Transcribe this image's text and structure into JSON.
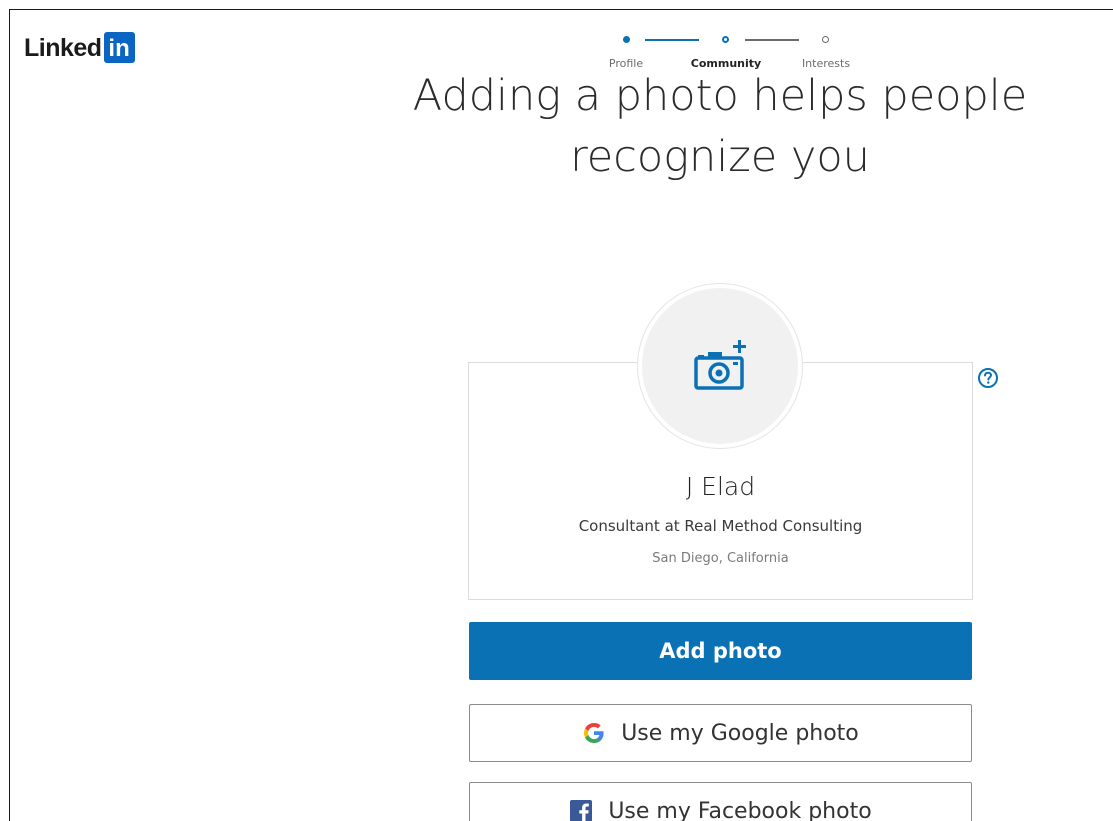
{
  "brand": {
    "logo_word": "Linked",
    "logo_box": "in",
    "accent_color": "#0a66c2"
  },
  "stepper": {
    "steps": [
      {
        "label": "Profile",
        "state": "complete"
      },
      {
        "label": "Community",
        "state": "current"
      },
      {
        "label": "Interests",
        "state": "upcoming"
      }
    ]
  },
  "headline": {
    "line1": "Adding a photo helps people",
    "line2": "recognize you"
  },
  "profile": {
    "name": "J Elad",
    "role": "Consultant at Real Method Consulting",
    "location": "San Diego, California",
    "avatar_icon": "camera-add-icon",
    "help_icon": "question-circle-icon"
  },
  "actions": {
    "add_photo_label": "Add photo",
    "google_label": "Use my Google photo",
    "google_icon": "google-icon",
    "facebook_label": "Use my Facebook photo",
    "facebook_icon": "facebook-icon",
    "primary_color": "#0a71b5"
  }
}
